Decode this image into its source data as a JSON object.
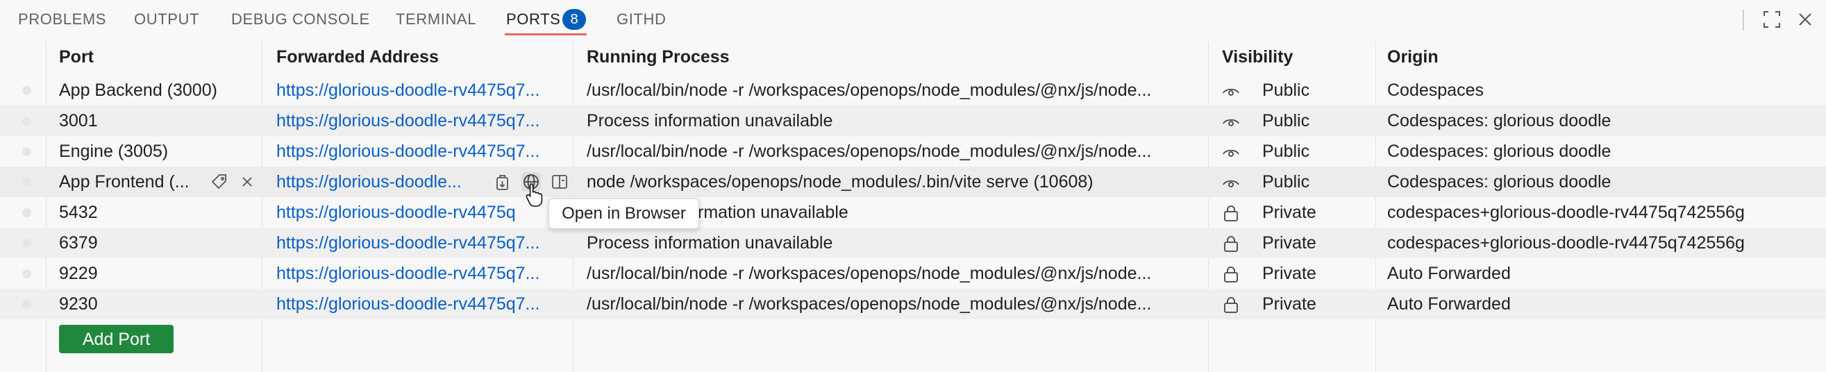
{
  "tabs": [
    {
      "label": "PROBLEMS"
    },
    {
      "label": "OUTPUT"
    },
    {
      "label": "DEBUG CONSOLE"
    },
    {
      "label": "TERMINAL"
    },
    {
      "label": "PORTS",
      "badge": "8",
      "active": true
    },
    {
      "label": "GITHD"
    }
  ],
  "toolbar_icons": [
    "maximize-icon",
    "close-icon"
  ],
  "columns": {
    "port": "Port",
    "address": "Forwarded Address",
    "process": "Running Process",
    "visibility": "Visibility",
    "origin": "Origin"
  },
  "rows": [
    {
      "port": "App Backend (3000)",
      "address": "https://glorious-doodle-rv4475q7...",
      "process": "/usr/local/bin/node -r /workspaces/openops/node_modules/@nx/js/node...",
      "visibility": "Public",
      "origin": "Codespaces"
    },
    {
      "port": "3001",
      "address": "https://glorious-doodle-rv4475q7...",
      "process": "Process information unavailable",
      "visibility": "Public",
      "origin": "Codespaces: glorious doodle"
    },
    {
      "port": "Engine (3005)",
      "address": "https://glorious-doodle-rv4475q7...",
      "process": "/usr/local/bin/node -r /workspaces/openops/node_modules/@nx/js/node...",
      "visibility": "Public",
      "origin": "Codespaces: glorious doodle"
    },
    {
      "port": "App Frontend (...",
      "address": "https://glorious-doodle...",
      "process": "node /workspaces/openops/node_modules/.bin/vite serve (10608)",
      "visibility": "Public",
      "origin": "Codespaces: glorious doodle"
    },
    {
      "port": "5432",
      "address": "https://glorious-doodle-rv4475q",
      "process": "rmation unavailable",
      "visibility": "Private",
      "origin": "codespaces+glorious-doodle-rv4475q742556g"
    },
    {
      "port": "6379",
      "address": "https://glorious-doodle-rv4475q7...",
      "process": "Process information unavailable",
      "visibility": "Private",
      "origin": "codespaces+glorious-doodle-rv4475q742556g"
    },
    {
      "port": "9229",
      "address": "https://glorious-doodle-rv4475q7...",
      "process": "/usr/local/bin/node -r /workspaces/openops/node_modules/@nx/js/node...",
      "visibility": "Private",
      "origin": "Auto Forwarded"
    },
    {
      "port": "9230",
      "address": "https://glorious-doodle-rv4475q7...",
      "process": "/usr/local/bin/node -r /workspaces/openops/node_modules/@nx/js/node...",
      "visibility": "Private",
      "origin": "Auto Forwarded"
    }
  ],
  "add_port_label": "Add Port",
  "tooltip": "Open in Browser",
  "colors": {
    "link": "#0a5fc5",
    "badge": "#005fb8",
    "add_button": "#1f883d",
    "active_underline": "#e36a6a"
  }
}
